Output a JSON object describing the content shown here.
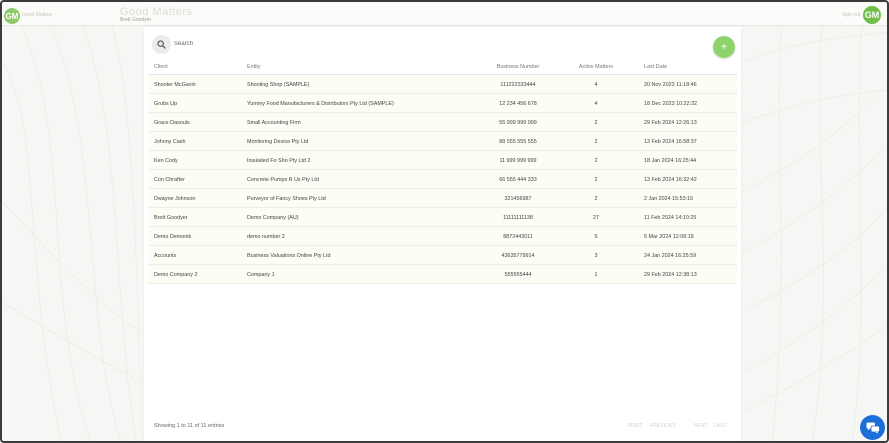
{
  "header": {
    "app_title": "Good Matters",
    "app_subtitle": "Brett Goodyer",
    "left_logo_text": "GM",
    "left_brand_text": "Good Matters",
    "right_text": "Sign out",
    "right_logo_text": "GM"
  },
  "search": {
    "placeholder": "Search"
  },
  "add_button": {
    "label": "+"
  },
  "table": {
    "headers": {
      "client": "Client",
      "entity": "Entity",
      "business_number": "Business Number",
      "active_matters": "Active Matters",
      "last_date": "Last Date"
    },
    "rows": [
      {
        "client": "Shooter McGavin",
        "entity": "Shooting Shop (SAMPLE)",
        "business_number": "111222333444",
        "active_matters": "4",
        "last_date": "20 Nov 2023 11:18:46"
      },
      {
        "client": "Grubs Up",
        "entity": "Yummy Food Manufacturers & Distributors Pty Ltd (SAMPLE)",
        "business_number": "12 234 456 678",
        "active_matters": "4",
        "last_date": "18 Dec 2023 10:22:32"
      },
      {
        "client": "Grace Dasouls",
        "entity": "Small Accounting Firm",
        "business_number": "55 999 999 999",
        "active_matters": "2",
        "last_date": "29 Feb 2024 12:26:13"
      },
      {
        "client": "Johnny Cash",
        "entity": "Monitoring Device Pty Ltd",
        "business_number": "88 555 555 555",
        "active_matters": "2",
        "last_date": "13 Feb 2024 16:58:37"
      },
      {
        "client": "Ken Cody",
        "entity": "Insulated Fo Sho Pty Ltd 2",
        "business_number": "11 999 999 999",
        "active_matters": "2",
        "last_date": "18 Jan 2024 16:25:44"
      },
      {
        "client": "Con Chrafter",
        "entity": "Concrete Pumps R Us Pty Ltd",
        "business_number": "66 555 444 333",
        "active_matters": "2",
        "last_date": "13 Feb 2024 16:32:42"
      },
      {
        "client": "Dwayne Johnson",
        "entity": "Purveyor of Fancy Shoes Pty Ltd",
        "business_number": "321456987",
        "active_matters": "2",
        "last_date": "2 Jan 2024 15:53:16"
      },
      {
        "client": "Brett Goodyer",
        "entity": "Demo Company (AU)",
        "business_number": "11111111138",
        "active_matters": "27",
        "last_date": "11 Feb 2024 14:10:25"
      },
      {
        "client": "Demo Demonik",
        "entity": "demo number 2",
        "business_number": "8872443011",
        "active_matters": "5",
        "last_date": "5 Mar 2024 12:08:18"
      },
      {
        "client": "Accounts",
        "entity": "Business Valuations Online Pty Ltd",
        "business_number": "43635779914",
        "active_matters": "3",
        "last_date": "24 Jan 2024 16:25:59"
      },
      {
        "client": "Demo Company 2",
        "entity": "Company 1",
        "business_number": "555555444",
        "active_matters": "1",
        "last_date": "29 Feb 2024 12:38:13"
      }
    ]
  },
  "footer": {
    "entries_text": "Showing 1 to 11 of 11 entries",
    "pager": {
      "first": "FIRST",
      "previous": "PREVIOUS",
      "next": "NEXT",
      "last": "LAST"
    }
  },
  "colors": {
    "accent": "#8fd36d",
    "row_highlight": "#fcfdf5",
    "chat_button": "#1c6fd8"
  },
  "icons": {
    "search": "search-icon",
    "add": "plus-icon",
    "chat": "chat-bubbles-icon"
  }
}
